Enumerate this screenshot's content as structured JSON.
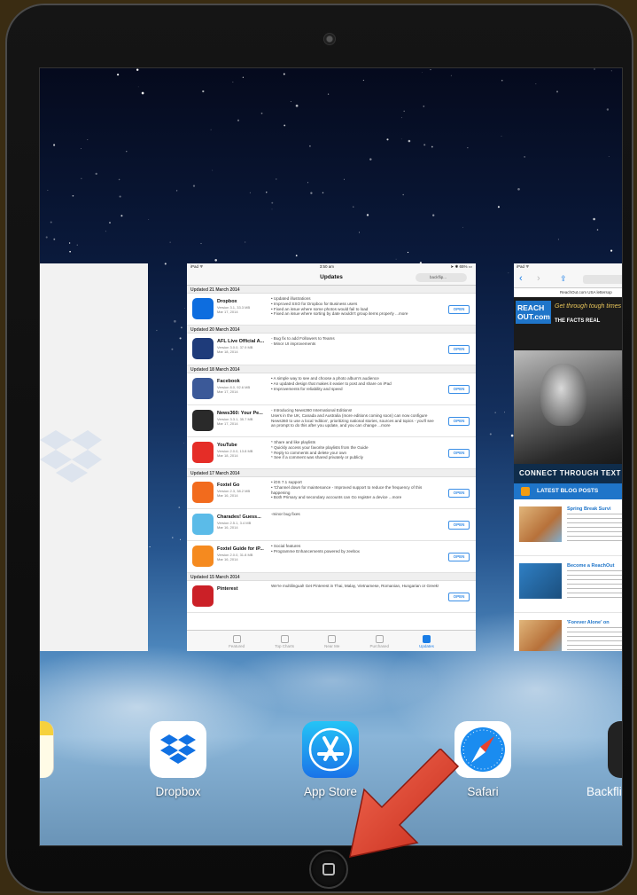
{
  "app_store_card": {
    "status_left": "iPad ᯤ",
    "status_time": "3:50 am",
    "status_right": "➤ ✱ 65% ▭",
    "title": "Updates",
    "search": "backflip...",
    "sections": [
      {
        "heading": "Updated 21 March 2014",
        "rows": [
          {
            "name": "Dropbox",
            "version": "Version 3.1, 33.3 MB",
            "date": "Mar 17, 2014",
            "notes": "• Updated illustrations\n• Improved SSO for Dropbox for Business users\n• Fixed an issue where some photos would fail to load\n• Fixed an issue where sorting by date wouldn't group items properly ...more",
            "color": "#0d6ddf",
            "icon": "dropbox-app-icon"
          }
        ]
      },
      {
        "heading": "Updated 20 March 2014",
        "rows": [
          {
            "name": "AFL Live Official A...",
            "version": "Version 3.0.0, 37.9 MB",
            "date": "Mar 18, 2014",
            "notes": "- Bug fix to add Followers to Teams\n- Minor UI improvements",
            "color": "#1e3b7a",
            "icon": "afl-app-icon"
          }
        ]
      },
      {
        "heading": "Updated 18 March 2014",
        "rows": [
          {
            "name": "Facebook",
            "version": "Version 8.0, 92.6 MB",
            "date": "Mar 17, 2014",
            "notes": "• A simple way to see and choose a photo album's audience\n• An updated design that makes it easier to post and share on iPad\n• Improvements for reliability and speed",
            "color": "#3b5998",
            "icon": "facebook-app-icon"
          },
          {
            "name": "News360: Your Pe...",
            "version": "Version 3.3.1, 35.7 MB",
            "date": "Mar 17, 2014",
            "notes": "- Introducing News360 International Editions!\nUsers in the UK, Canada and Australia (more editions coming soon) can now configure News360 to use a local 'edition', prioritizing national stories, sources and topics - you'll see an prompt to do this after you update, and you can change ...more",
            "color": "#2a2a2a",
            "icon": "news360-app-icon"
          },
          {
            "name": "YouTube",
            "version": "Version 2.0.0, 13.8 MB",
            "date": "Mar 18, 2014",
            "notes": "* Share and like playlists\n* Quickly access your favorite playlists from the Guide\n* Reply to comments and delete your own\n* See if a comment was shared privately or publicly",
            "color": "#e52d27",
            "icon": "youtube-app-icon"
          }
        ]
      },
      {
        "heading": "Updated 17 March 2014",
        "rows": [
          {
            "name": "Foxtel Go",
            "version": "Version 2.3, 38.2 MB",
            "date": "Mar 16, 2014",
            "notes": "• iOS 7.1 support\n• 'Channel down for maintenance - Improved support to reduce the frequency of this happening\n• Both Primary and secondary accounts can Go register a device ...more",
            "color": "#f26b1d",
            "icon": "foxtel-go-app-icon"
          },
          {
            "name": "Charades! Guess...",
            "version": "Version 2.5.1, 3.4 MB",
            "date": "Mar 16, 2014",
            "notes": "-minor bug fixes",
            "color": "#5bbbe8",
            "icon": "charades-app-icon"
          },
          {
            "name": "Foxtel Guide for iP...",
            "version": "Version 2.0.0, 31.8 MB",
            "date": "Mar 16, 2014",
            "notes": "• Social features\n• Programme Enhancements powered by zeebox",
            "color": "#f58a1f",
            "icon": "foxtel-guide-app-icon"
          }
        ]
      },
      {
        "heading": "Updated 15 March 2014",
        "rows": [
          {
            "name": "Pinterest",
            "version": "",
            "date": "",
            "notes": "We're multilingual! Get Pinterest in Thai, Malay, Vietnamese, Romanian, Hungarian or Greek!",
            "color": "#cb2027",
            "icon": "pinterest-app-icon"
          }
        ]
      }
    ],
    "open_label": "OPEN",
    "tabs": [
      {
        "label": "Featured",
        "active": false
      },
      {
        "label": "Top Charts",
        "active": false
      },
      {
        "label": "Near Me",
        "active": false
      },
      {
        "label": "Purchased",
        "active": false
      },
      {
        "label": "Updates",
        "active": true
      }
    ]
  },
  "safari_card": {
    "status": "iPad ᯤ",
    "back": "‹",
    "forward": "›",
    "url": "ReachOut.com USA lettersop",
    "logo": "REACH OUT.com",
    "tagline": "Get through tough times",
    "facts": "THE FACTS  REAL",
    "connect": "CONNECT THROUGH TEXT",
    "blog_heading": "LATEST BLOG POSTS",
    "posts": [
      {
        "title": "Spring Break Survi"
      },
      {
        "title": "Become a ReachOut"
      },
      {
        "title": "'Forever Alone' on"
      }
    ]
  },
  "dock": [
    {
      "label": "Dropbox",
      "icon": "dropbox-icon"
    },
    {
      "label": "App Store",
      "icon": "app-store-icon"
    },
    {
      "label": "Safari",
      "icon": "safari-icon"
    },
    {
      "label": "Backfli",
      "icon": "backflip-icon"
    }
  ],
  "colors": {
    "accent": "#1a7de6",
    "arrow": "#e8432e",
    "app_store_blue": "#1a8cf0"
  }
}
